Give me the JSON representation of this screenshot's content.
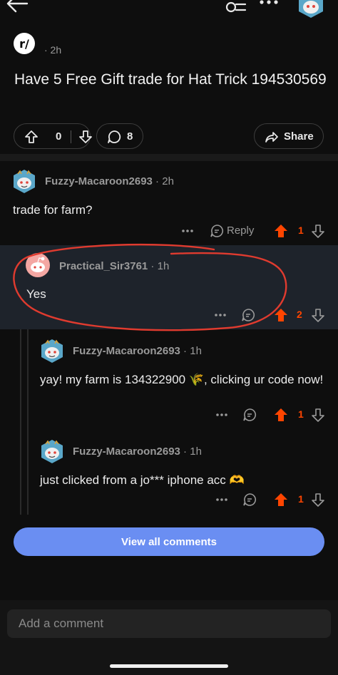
{
  "post": {
    "subreddit_icon_text": "r/",
    "age": "· 2h",
    "title": "Have 5 Free Gift trade for Hat Trick 194530569",
    "votes": "0",
    "comments": "8",
    "share_label": "Share"
  },
  "comments": [
    {
      "author": "Fuzzy-Macaroon2693",
      "time": " · 2h",
      "body": "trade for farm?",
      "votes": "1",
      "reply_label": "Reply"
    },
    {
      "author": "Practical_Sir3761",
      "time": " · 1h",
      "body": "Yes",
      "votes": "2"
    },
    {
      "author": "Fuzzy-Macaroon2693",
      "time": " · 1h",
      "body": "yay! my farm is 134322900 🌾, clicking ur code now!",
      "votes": "1"
    },
    {
      "author": "Fuzzy-Macaroon2693",
      "time": " · 1h",
      "body": "just clicked from a jo*** iphone acc 🫶",
      "votes": "1"
    }
  ],
  "view_all_label": "View all comments",
  "add_comment_placeholder": "Add a comment",
  "colors": {
    "accent": "#ff4500",
    "button": "#6a8ef2",
    "annotation": "#e03b2f",
    "highlight": "#1e232b"
  },
  "icons": [
    "back-arrow-icon",
    "search-icon",
    "more-icon",
    "upvote-icon",
    "downvote-icon",
    "comment-icon",
    "share-icon",
    "emoji-icon"
  ]
}
